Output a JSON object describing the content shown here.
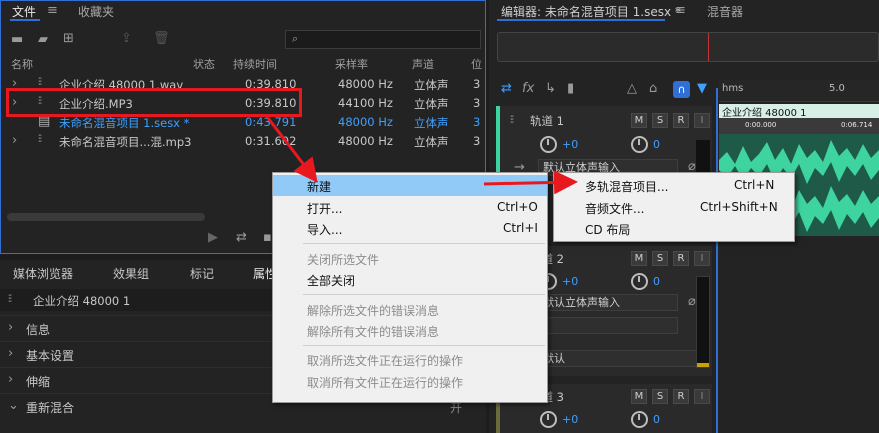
{
  "files_panel": {
    "tabs": [
      "文件",
      "收藏夹"
    ],
    "columns": [
      "名称",
      "状态",
      "持续时间",
      "采样率",
      "声道",
      "位"
    ],
    "rows": [
      {
        "name": "企业介绍 48000 1.wav",
        "duration": "0:39.810",
        "rate": "48000 Hz",
        "channels": "立体声",
        "bits": "3"
      },
      {
        "name": "企业介绍.MP3",
        "duration": "0:39.810",
        "rate": "44100 Hz",
        "channels": "立体声",
        "bits": "3"
      },
      {
        "name": "未命名混音项目 1.sesx *",
        "duration": "0:43.791",
        "rate": "48000 Hz",
        "channels": "立体声",
        "bits": "3"
      },
      {
        "name": "未命名混音项目...混.mp3",
        "duration": "0:31.602",
        "rate": "48000 Hz",
        "channels": "立体声",
        "bits": "3"
      }
    ]
  },
  "props_panel": {
    "tabs": [
      "媒体浏览器",
      "效果组",
      "标记",
      "属性"
    ],
    "file_name": "企业介绍 48000 1",
    "sections": [
      "信息",
      "基本设置",
      "伸缩",
      "重新混合"
    ],
    "remix_state": "开"
  },
  "editor": {
    "tab_title": "编辑器: 未命名混音项目 1.sesx *",
    "mixer_tab": "混音器",
    "ruler_unit": "hms",
    "ruler_mark": "5.0",
    "tracks": [
      {
        "name": "轨道 1",
        "volume": "+0",
        "pan": "0",
        "input": "默认立体声输入"
      },
      {
        "name": "轨道 2",
        "volume": "+0",
        "pan": "0",
        "input": "默认立体声输入"
      },
      {
        "name": "轨道 3",
        "volume": "+0",
        "pan": "0"
      }
    ],
    "track2_out": "默认",
    "clip_name": "企业介绍 48000 1",
    "clip_start": "0:00.000",
    "clip_end": "0:06.714",
    "track_buttons": [
      "M",
      "S",
      "R",
      "I"
    ]
  },
  "context_menu": {
    "items": [
      {
        "label": "新建",
        "shortcut": "",
        "enabled": true,
        "submenu": true
      },
      {
        "label": "打开...",
        "shortcut": "Ctrl+O",
        "enabled": true
      },
      {
        "label": "导入...",
        "shortcut": "Ctrl+I",
        "enabled": true
      },
      {
        "label": "关闭所选文件",
        "shortcut": "",
        "enabled": false
      },
      {
        "label": "全部关闭",
        "shortcut": "",
        "enabled": true
      },
      {
        "label": "解除所选文件的错误消息",
        "shortcut": "",
        "enabled": false
      },
      {
        "label": "解除所有文件的错误消息",
        "shortcut": "",
        "enabled": false
      },
      {
        "label": "取消所选文件正在运行的操作",
        "shortcut": "",
        "enabled": false
      },
      {
        "label": "取消所有文件正在运行的操作",
        "shortcut": "",
        "enabled": false
      }
    ]
  },
  "submenu": {
    "items": [
      {
        "label": "多轨混音项目...",
        "shortcut": "Ctrl+N"
      },
      {
        "label": "音频文件...",
        "shortcut": "Ctrl+Shift+N"
      },
      {
        "label": "CD 布局",
        "shortcut": ""
      }
    ]
  },
  "colors": {
    "accent": "#2f6fd6",
    "selected_text": "#3ea0ff",
    "waveform": "#3ed4a0",
    "annotation": "#e8191e",
    "highlight": "#91c9f7"
  }
}
